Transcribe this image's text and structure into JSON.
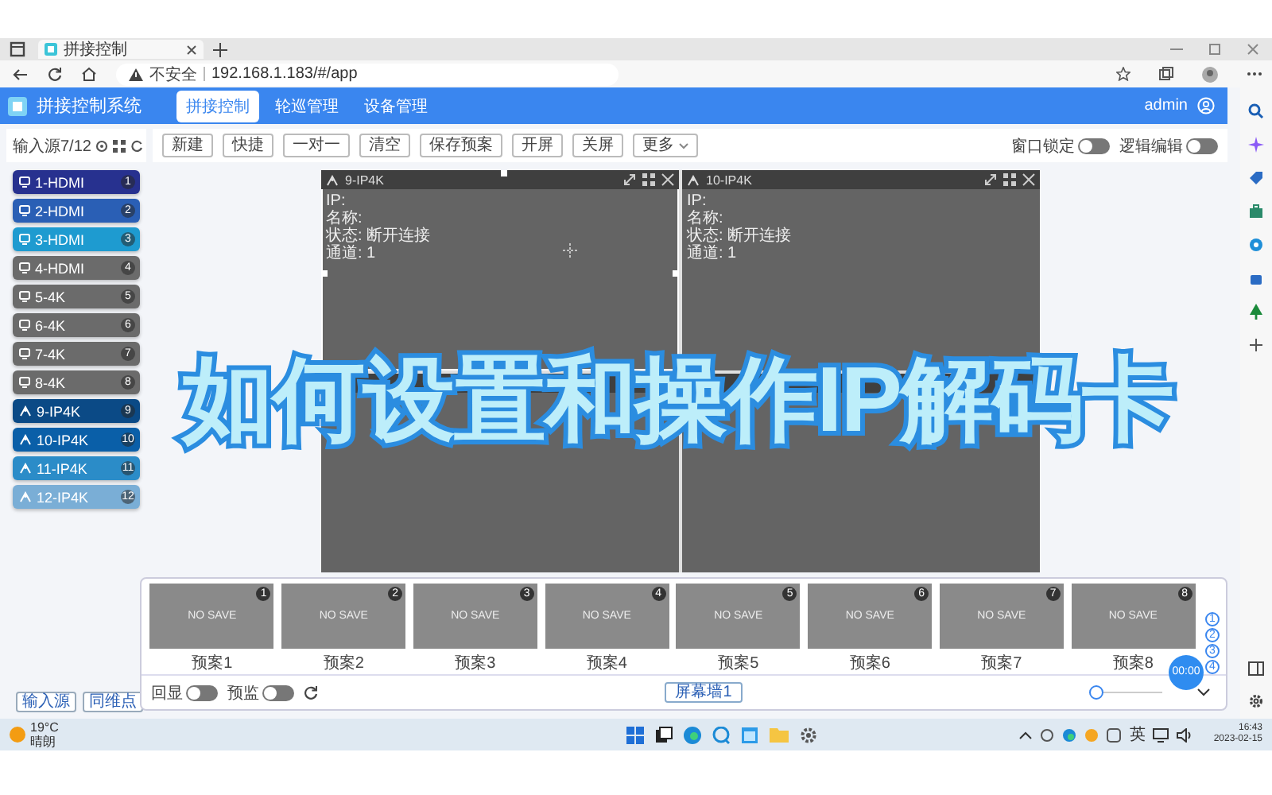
{
  "browser": {
    "tab_title": "拼接控制",
    "security": "不安全",
    "url": "192.168.1.183/#/app"
  },
  "app": {
    "title": "拼接控制系统",
    "user": "admin",
    "nav": [
      {
        "label": "拼接控制",
        "selected": true
      },
      {
        "label": "轮巡管理",
        "selected": false
      },
      {
        "label": "设备管理",
        "selected": false
      }
    ]
  },
  "sources": {
    "header": "输入源7/12",
    "items": [
      {
        "label": "1-HDMI",
        "number": "1",
        "kind": "hdmi",
        "color": "#27318f"
      },
      {
        "label": "2-HDMI",
        "number": "2",
        "kind": "hdmi",
        "color": "#2a5fb5"
      },
      {
        "label": "3-HDMI",
        "number": "3",
        "kind": "hdmi",
        "color": "#1e9bd0"
      },
      {
        "label": "4-HDMI",
        "number": "4",
        "kind": "hdmi",
        "color": "#6b6b6b"
      },
      {
        "label": "5-4K",
        "number": "5",
        "kind": "hdmi",
        "color": "#6b6b6b"
      },
      {
        "label": "6-4K",
        "number": "6",
        "kind": "hdmi",
        "color": "#6b6b6b"
      },
      {
        "label": "7-4K",
        "number": "7",
        "kind": "hdmi",
        "color": "#6b6b6b"
      },
      {
        "label": "8-4K",
        "number": "8",
        "kind": "hdmi",
        "color": "#6b6b6b"
      },
      {
        "label": "9-IP4K",
        "number": "9",
        "kind": "ip",
        "color": "#0b4a86"
      },
      {
        "label": "10-IP4K",
        "number": "10",
        "kind": "ip",
        "color": "#0a5fa8"
      },
      {
        "label": "11-IP4K",
        "number": "11",
        "kind": "ip",
        "color": "#2b8cc8"
      },
      {
        "label": "12-IP4K",
        "number": "12",
        "kind": "ip",
        "color": "#7aaed6"
      }
    ],
    "buttons": [
      "输入源",
      "同维点"
    ]
  },
  "toolbar": {
    "buttons": [
      {
        "label": "新建",
        "kind": "plain"
      },
      {
        "label": "快捷",
        "kind": "plain"
      },
      {
        "label": "一对一",
        "kind": "plain"
      },
      {
        "label": "清空",
        "kind": "plain"
      },
      {
        "label": "保存预案",
        "kind": "plain"
      },
      {
        "label": "开屏",
        "kind": "plain"
      },
      {
        "label": "关屏",
        "kind": "plain"
      },
      {
        "label": "更多",
        "kind": "dropdown"
      }
    ],
    "toggles": [
      {
        "label": "窗口锁定",
        "on": false
      },
      {
        "label": "逻辑编辑",
        "on": false
      }
    ]
  },
  "wall": {
    "windows": [
      {
        "title": "9-IP4K",
        "selected": true,
        "lines": [
          "IP:",
          "名称:",
          "状态: 断开连接",
          "通道: 1"
        ]
      },
      {
        "title": "10-IP4K",
        "selected": false,
        "lines": [
          "IP:",
          "名称:",
          "状态: 断开连接",
          "通道: 1"
        ]
      },
      {
        "selected": false
      },
      {
        "selected": false
      }
    ]
  },
  "presets": {
    "items": [
      {
        "name": "预案1",
        "number": "1",
        "state": "NO SAVE"
      },
      {
        "name": "预案2",
        "number": "2",
        "state": "NO SAVE"
      },
      {
        "name": "预案3",
        "number": "3",
        "state": "NO SAVE"
      },
      {
        "name": "预案4",
        "number": "4",
        "state": "NO SAVE"
      },
      {
        "name": "预案5",
        "number": "5",
        "state": "NO SAVE"
      },
      {
        "name": "预案6",
        "number": "6",
        "state": "NO SAVE"
      },
      {
        "name": "预案7",
        "number": "7",
        "state": "NO SAVE"
      },
      {
        "name": "预案8",
        "number": "8",
        "state": "NO SAVE"
      }
    ],
    "pages": [
      "1",
      "2",
      "3",
      "4"
    ]
  },
  "bottom_bar": {
    "toggles": [
      {
        "label": "回显",
        "on": false
      },
      {
        "label": "预监",
        "on": false
      }
    ],
    "wall_button": "屏幕墙1",
    "zoom": {
      "level": 0
    },
    "timer": "00:00"
  },
  "taskbar": {
    "temperature": "19°C",
    "weather": "晴朗",
    "ime": "英",
    "time": "16:43",
    "date": "2023-02-15"
  },
  "caption": "如何设置和操作IP解码卡"
}
